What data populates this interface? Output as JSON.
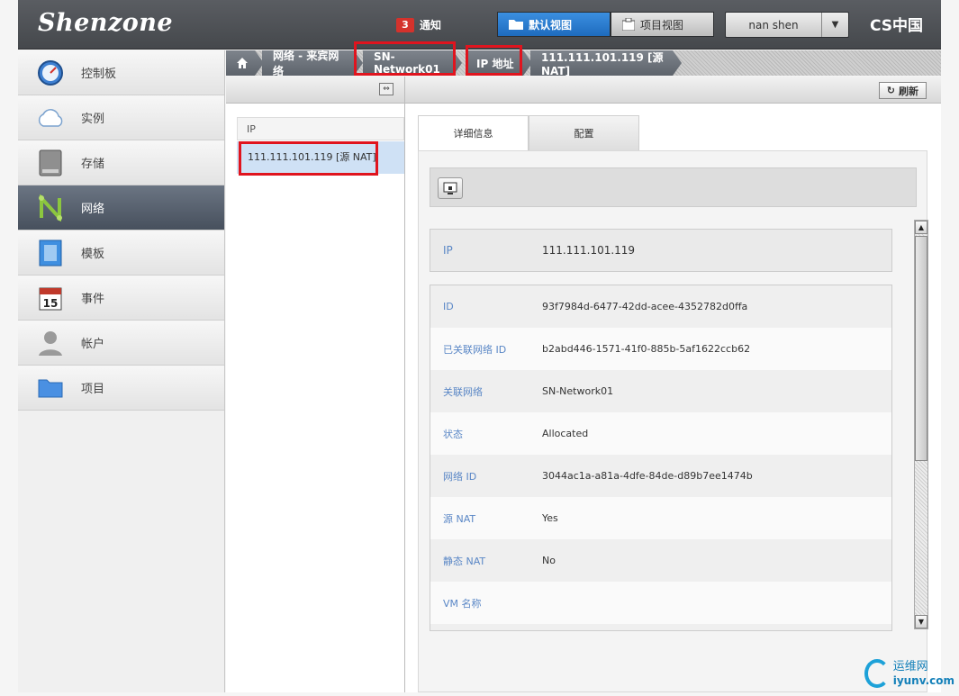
{
  "header": {
    "logo": "Shenzone",
    "notifications": {
      "count": "3",
      "label": "通知"
    },
    "views": {
      "default": "默认视图",
      "project": "项目视图"
    },
    "user": "nan shen",
    "brand": "CS中国"
  },
  "sidebar": {
    "items": [
      {
        "label": "控制板",
        "icon": "dashboard-icon"
      },
      {
        "label": "实例",
        "icon": "cloud-icon"
      },
      {
        "label": "存储",
        "icon": "storage-icon"
      },
      {
        "label": "网络",
        "icon": "network-icon",
        "active": true
      },
      {
        "label": "模板",
        "icon": "template-icon"
      },
      {
        "label": "事件",
        "icon": "calendar-icon"
      },
      {
        "label": "帐户",
        "icon": "user-icon"
      },
      {
        "label": "项目",
        "icon": "folder-icon"
      }
    ]
  },
  "breadcrumb": {
    "home_icon": "home-icon",
    "items": [
      "网络 - 来宾网络",
      "SN-Network01",
      "IP 地址",
      "111.111.101.119 [源 NAT]"
    ]
  },
  "list": {
    "header": "IP",
    "rows": [
      "111.111.101.119 [源 NAT]"
    ]
  },
  "detail": {
    "refresh": "刷新",
    "tabs": [
      "详细信息",
      "配置"
    ],
    "ip": {
      "label": "IP",
      "value": "111.111.101.119"
    },
    "fields": [
      {
        "label": "ID",
        "value": "93f7984d-6477-42dd-acee-4352782d0ffa"
      },
      {
        "label": "已关联网络 ID",
        "value": "b2abd446-1571-41f0-885b-5af1622ccb62"
      },
      {
        "label": "关联网络",
        "value": "SN-Network01"
      },
      {
        "label": "状态",
        "value": "Allocated"
      },
      {
        "label": "网络 ID",
        "value": "3044ac1a-a81a-4dfe-84de-d89b7ee1474b"
      },
      {
        "label": "源 NAT",
        "value": "Yes"
      },
      {
        "label": "静态 NAT",
        "value": "No"
      },
      {
        "label": "VM 名称",
        "value": ""
      },
      {
        "label": "",
        "value": ""
      }
    ]
  },
  "watermark": {
    "text": "运维网",
    "url": "iyunv.com"
  },
  "colors": {
    "highlight": "#e0141e",
    "active_view": "#1e6bbe",
    "label_blue": "#5a87c6"
  }
}
